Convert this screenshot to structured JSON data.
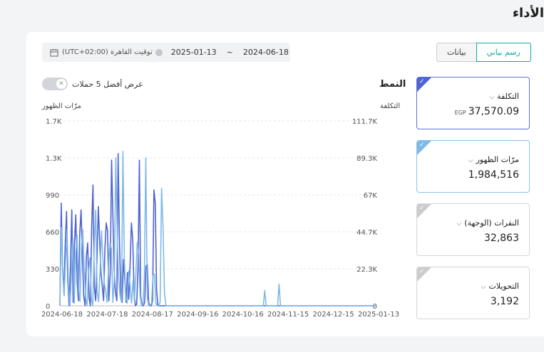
{
  "page": {
    "title": "الأداء"
  },
  "filters": {
    "date_from": "2024-06-18",
    "date_to": "2025-01-13",
    "separator": "~",
    "timezone": "(UTC+02:00) توقيت القاهرة",
    "calendar_icon": "calendar-icon"
  },
  "view_toggle": {
    "chart_label": "رسم بياني",
    "data_label": "بيانات",
    "selected": "chart"
  },
  "top_campaigns": {
    "label": "عرض أفضل 5 حملات",
    "enabled": false
  },
  "chart": {
    "pattern_title": "النمط"
  },
  "metrics": [
    {
      "label": "التكلفة",
      "unit": "EGP",
      "value": "37,570.09",
      "selected": true,
      "color": "#4f63d2"
    },
    {
      "label": "مرّات الظهور",
      "unit": "",
      "value": "1,984,516",
      "selected": true,
      "color": "#7fb9e6"
    },
    {
      "label": "النقرات (الوجهة)",
      "unit": "",
      "value": "32,863",
      "selected": false,
      "color": "#cccccc"
    },
    {
      "label": "التحويلات",
      "unit": "",
      "value": "3,192",
      "selected": false,
      "color": "#cccccc"
    }
  ],
  "chart_data": {
    "type": "line",
    "x_ticks": [
      "2024-06-18",
      "2024-07-18",
      "2024-08-17",
      "2024-09-16",
      "2024-10-16",
      "2024-11-15",
      "2024-12-15",
      "2025-01-13"
    ],
    "left_axis": {
      "label": "مرّات الظهور",
      "ticks": [
        "0",
        "330",
        "660",
        "990",
        "1.3K",
        "1.7K"
      ],
      "ylim": [
        0,
        1700
      ]
    },
    "right_axis": {
      "label": "التكلفة",
      "ticks": [
        "0",
        "22.3K",
        "44.7K",
        "67K",
        "89.3K",
        "111.7K"
      ],
      "ylim": [
        0,
        111700
      ]
    },
    "grid": true,
    "series": [
      {
        "name": "التكلفة",
        "color": "#4f63d2",
        "axis": "right",
        "values": [
          0,
          62000,
          24000,
          8000,
          36000,
          57000,
          15000,
          0,
          25000,
          58000,
          2000,
          38000,
          55000,
          14000,
          3000,
          44000,
          58000,
          30000,
          6000,
          0,
          30000,
          38000,
          5000,
          0,
          48000,
          73000,
          12000,
          3000,
          28000,
          60000,
          40000,
          20000,
          12000,
          3000,
          35000,
          50000,
          45000,
          3000,
          20000,
          88000,
          55000,
          20000,
          8000,
          3000,
          92000,
          38000,
          8000,
          2000,
          28000,
          16000,
          2000,
          20000,
          4000,
          25000,
          50000,
          40000,
          8000,
          0,
          1000,
          23000,
          88000,
          6000,
          0,
          0,
          2000,
          24000,
          25000,
          2000,
          0,
          0,
          3000,
          70000,
          62000,
          10000,
          0,
          0,
          0,
          0,
          0,
          0,
          0,
          0,
          0,
          0,
          0,
          0,
          0,
          0,
          0,
          0,
          0,
          0,
          0,
          0,
          0,
          0,
          0,
          0,
          0,
          0,
          0,
          0,
          0,
          0,
          0,
          0,
          0,
          0,
          0,
          0,
          0,
          0,
          0,
          0,
          0,
          0,
          0,
          0,
          0,
          0,
          0,
          0,
          0,
          0,
          0,
          0,
          0,
          0,
          0,
          0,
          0,
          0,
          0,
          0,
          0,
          0,
          0,
          0,
          0,
          0,
          0,
          0,
          0,
          0,
          0,
          0,
          0,
          0,
          0,
          0,
          0,
          0,
          0,
          0,
          0,
          0,
          0,
          0,
          0,
          0,
          0,
          0,
          0,
          0,
          0,
          0,
          0,
          0,
          0,
          0,
          0,
          0,
          0,
          0,
          0,
          0,
          0,
          0,
          0,
          0,
          0,
          0,
          0,
          0,
          0,
          0,
          0,
          0,
          0,
          0,
          0,
          0,
          0,
          0,
          0,
          0,
          0,
          0,
          0,
          0,
          0,
          0,
          0,
          0,
          0,
          0,
          0,
          0,
          0,
          0,
          0,
          0,
          0,
          0,
          0,
          0,
          0,
          0,
          0,
          0,
          0,
          0,
          0,
          0,
          0,
          0,
          0,
          0,
          0,
          0,
          0,
          0,
          0,
          0,
          0,
          0,
          0,
          0,
          0,
          0
        ]
      },
      {
        "name": "مرّات الظهور",
        "color": "#7fb9e6",
        "axis": "left",
        "values": [
          0,
          720,
          300,
          90,
          420,
          700,
          180,
          0,
          280,
          620,
          25,
          480,
          650,
          150,
          40,
          520,
          700,
          340,
          70,
          0,
          330,
          440,
          60,
          0,
          560,
          880,
          130,
          35,
          310,
          690,
          440,
          210,
          130,
          30,
          390,
          580,
          520,
          30,
          230,
          1360,
          640,
          240,
          90,
          35,
          1420,
          430,
          90,
          25,
          320,
          185,
          25,
          230,
          45,
          290,
          580,
          460,
          90,
          0,
          10,
          270,
          1360,
          70,
          0,
          0,
          25,
          280,
          290,
          25,
          0,
          0,
          35,
          1080,
          720,
          120,
          0,
          0,
          0,
          0,
          0,
          0,
          0,
          0,
          0,
          0,
          0,
          0,
          0,
          0,
          0,
          0,
          0,
          0,
          0,
          0,
          0,
          0,
          0,
          0,
          0,
          0,
          0,
          0,
          0,
          0,
          0,
          0,
          0,
          0,
          0,
          0,
          0,
          0,
          0,
          0,
          0,
          0,
          0,
          0,
          0,
          0,
          0,
          0,
          0,
          0,
          0,
          0,
          0,
          0,
          0,
          0,
          0,
          0,
          0,
          0,
          0,
          0,
          0,
          0,
          0,
          0,
          0,
          0,
          0,
          140,
          0,
          0,
          0,
          0,
          0,
          0,
          0,
          0,
          0,
          200,
          0,
          0,
          0,
          0,
          0,
          0,
          0,
          0,
          0,
          0,
          0,
          0,
          0,
          0,
          0,
          0,
          0,
          0,
          0,
          0,
          0,
          0,
          0,
          0,
          0,
          0,
          0,
          0,
          0,
          0,
          0,
          0,
          0,
          0,
          0,
          0,
          0,
          0,
          0,
          0,
          0,
          0,
          0,
          0,
          0,
          0,
          0,
          0,
          0,
          0,
          0,
          0,
          0,
          0,
          0,
          0,
          0,
          0,
          0,
          0,
          0,
          0,
          0,
          0,
          0,
          0,
          0,
          0
        ]
      }
    ]
  }
}
